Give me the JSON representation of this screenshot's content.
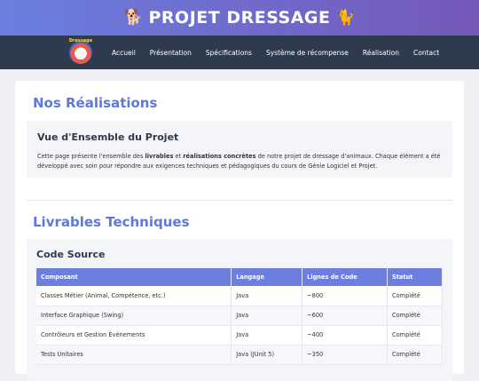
{
  "header": {
    "title": "PROJET DRESSAGE",
    "emoji_left": "🐕",
    "emoji_right": "🐈",
    "gradient_start": "#6a7fe0",
    "gradient_end": "#7558b8"
  },
  "nav": {
    "logo_text": "Dressage",
    "items": [
      "Accueil",
      "Présentation",
      "Spécifications",
      "Système de récompense",
      "Réalisation",
      "Contact"
    ],
    "background": "#2e3b4e"
  },
  "realisations": {
    "title": "Nos Réalisations",
    "overview_title": "Vue d'Ensemble du Projet",
    "text_1": "Cette page présente l'ensemble des ",
    "bold_1": "livrables",
    "text_2": " et ",
    "bold_2": "réalisations concrètes",
    "text_3": " de notre projet de dressage d'animaux. Chaque élément a été développé avec soin pour répondre aux exigences techniques et pédagogiques du cours de Génie Logiciel et Projet."
  },
  "livrables": {
    "title": "Livrables Techniques",
    "subtitle": "Code Source",
    "columns": [
      "Composant",
      "Langage",
      "Lignes de Code",
      "Statut"
    ],
    "rows": [
      [
        "Classes Métier (Animal, Compétence, etc.)",
        "Java",
        "~800",
        "Complété"
      ],
      [
        "Interface Graphique (Swing)",
        "Java",
        "~600",
        "Complété"
      ],
      [
        "Contrôleurs et Gestion Événements",
        "Java",
        "~400",
        "Complété"
      ],
      [
        "Tests Unitaires",
        "Java (JUnit 5)",
        "~350",
        "Complété"
      ]
    ]
  },
  "colors": {
    "accent": "#5f78dc",
    "table_header": "#6a7fe0"
  }
}
